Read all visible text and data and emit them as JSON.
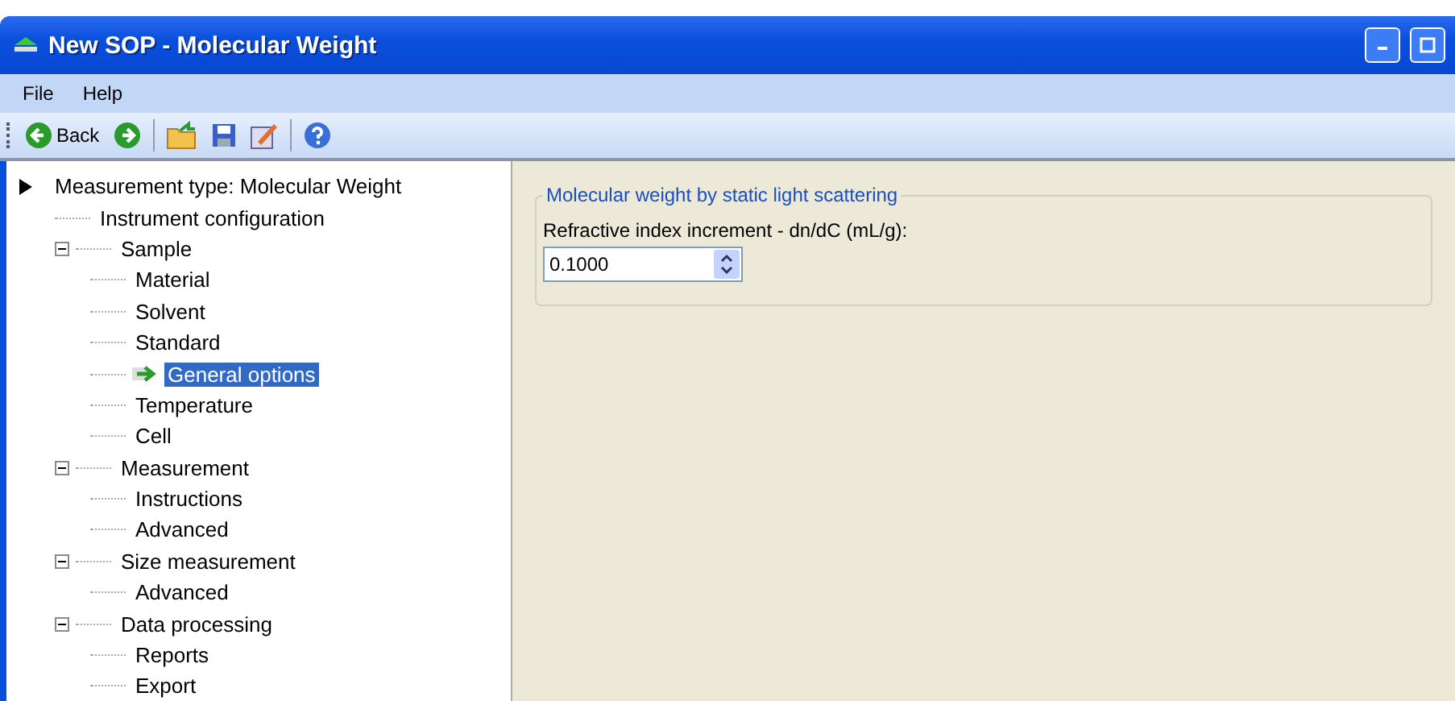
{
  "window": {
    "title": "New SOP - Molecular Weight"
  },
  "menu": [
    "File",
    "Help"
  ],
  "toolbar": {
    "back_label": "Back"
  },
  "tree": {
    "root": "Measurement type: Molecular Weight",
    "items": [
      {
        "label": "Instrument configuration",
        "selected": false
      },
      {
        "label": "Sample",
        "selected": false,
        "expanded": true,
        "children": [
          {
            "label": "Material",
            "selected": false
          },
          {
            "label": "Solvent",
            "selected": false
          },
          {
            "label": "Standard",
            "selected": false
          },
          {
            "label": "General options",
            "selected": true
          },
          {
            "label": "Temperature",
            "selected": false
          },
          {
            "label": "Cell",
            "selected": false
          }
        ]
      },
      {
        "label": "Measurement",
        "selected": false,
        "expanded": true,
        "children": [
          {
            "label": "Instructions",
            "selected": false
          },
          {
            "label": "Advanced",
            "selected": false
          }
        ]
      },
      {
        "label": "Size measurement",
        "selected": false,
        "expanded": true,
        "children": [
          {
            "label": "Advanced",
            "selected": false
          }
        ]
      },
      {
        "label": "Data processing",
        "selected": false,
        "expanded": true,
        "children": [
          {
            "label": "Reports",
            "selected": false
          },
          {
            "label": "Export",
            "selected": false
          }
        ]
      }
    ]
  },
  "group": {
    "title": "Molecular weight by static light scattering",
    "field_label": "Refractive index increment - dn/dC (mL/g):",
    "value": "0.1000"
  }
}
